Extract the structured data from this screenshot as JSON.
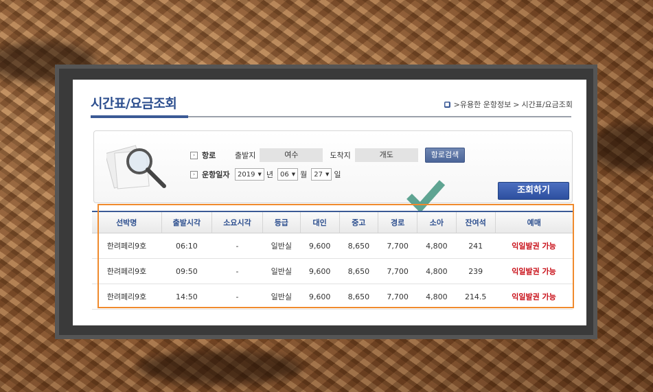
{
  "page": {
    "title": "시간표/요금조회",
    "breadcrumb": [
      ">유용한 운항정보",
      ">",
      "시간표/요금조회"
    ]
  },
  "search": {
    "route_label": "항로",
    "departure_label": "출발지",
    "departure_value": "여수",
    "arrival_label": "도착지",
    "arrival_value": "개도",
    "route_search_button": "항로검색",
    "date_label": "운항일자",
    "year": "2019",
    "year_unit": "년",
    "month": "06",
    "month_unit": "월",
    "day": "27",
    "day_unit": "일",
    "query_button": "조회하기"
  },
  "table": {
    "headers": [
      "선박명",
      "출발시각",
      "소요시각",
      "등급",
      "대인",
      "중고",
      "경로",
      "소아",
      "잔여석",
      "예매"
    ],
    "rows": [
      [
        "한려페리9호",
        "06:10",
        "-",
        "일반실",
        "9,600",
        "8,650",
        "7,700",
        "4,800",
        "241",
        "익일발권 가능"
      ],
      [
        "한려페리9호",
        "09:50",
        "-",
        "일반실",
        "9,600",
        "8,650",
        "7,700",
        "4,800",
        "239",
        "익일발권 가능"
      ],
      [
        "한려페리9호",
        "14:50",
        "-",
        "일반실",
        "9,600",
        "8,650",
        "7,700",
        "4,800",
        "214.5",
        "익일발권 가능"
      ]
    ]
  },
  "colors": {
    "accent": "#3b5a96",
    "highlight_box": "#f08a2c",
    "checkmark": "#4e9a86",
    "booking_text": "#c80e17"
  }
}
